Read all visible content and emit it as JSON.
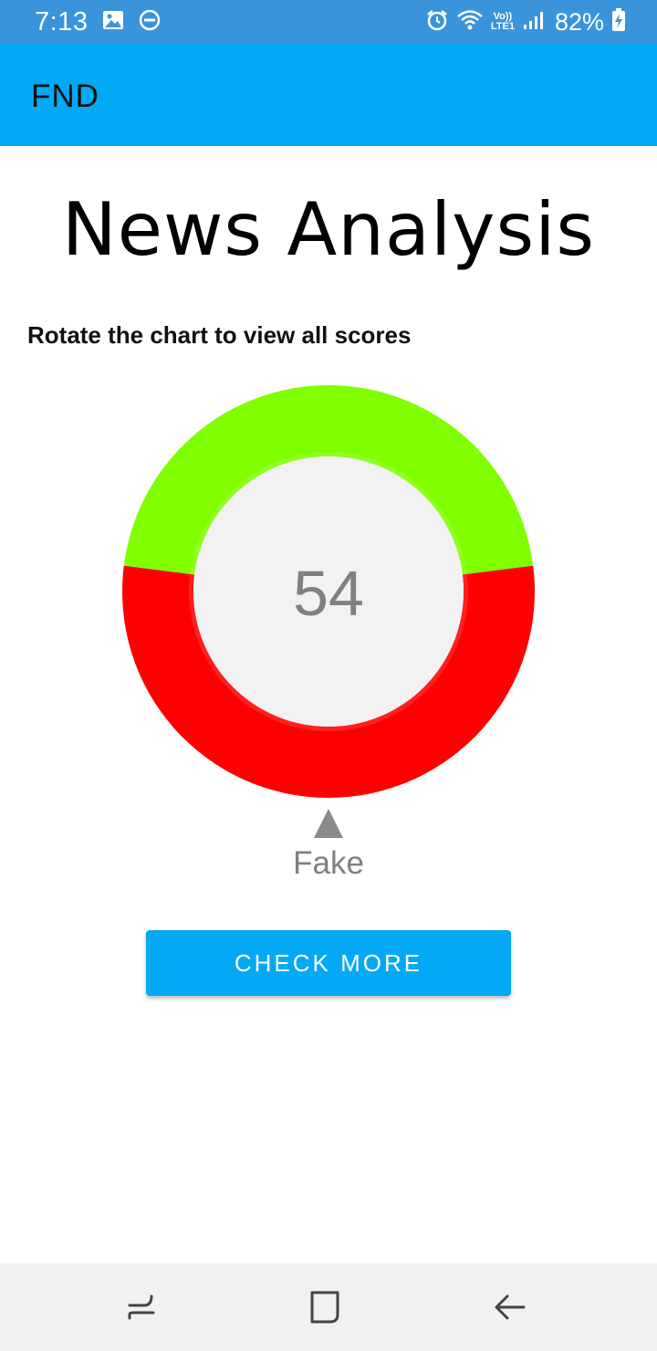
{
  "status_bar": {
    "time": "7:13",
    "battery": "82%",
    "icons": [
      "gallery-icon",
      "dnd-icon",
      "alarm-icon",
      "wifi-icon",
      "volte-lte-icon",
      "signal-icon",
      "battery-charging-icon"
    ],
    "volte_text": "Vo))",
    "lte_text": "LTE1"
  },
  "app_bar": {
    "title": "FND",
    "color": "#03a9f4"
  },
  "main": {
    "heading": "News Analysis",
    "hint": "Rotate the chart to view all scores",
    "score": "54",
    "pointer_label": "Fake",
    "button_label": "CHECK MORE"
  },
  "chart_data": {
    "type": "pie",
    "donut": true,
    "center_label": "54",
    "slices": [
      {
        "color": "#ff0000",
        "value": 54
      },
      {
        "color": "#80ff00",
        "value": 46
      }
    ]
  },
  "nav_bar": {
    "items": [
      "recent-apps",
      "home",
      "back"
    ]
  }
}
